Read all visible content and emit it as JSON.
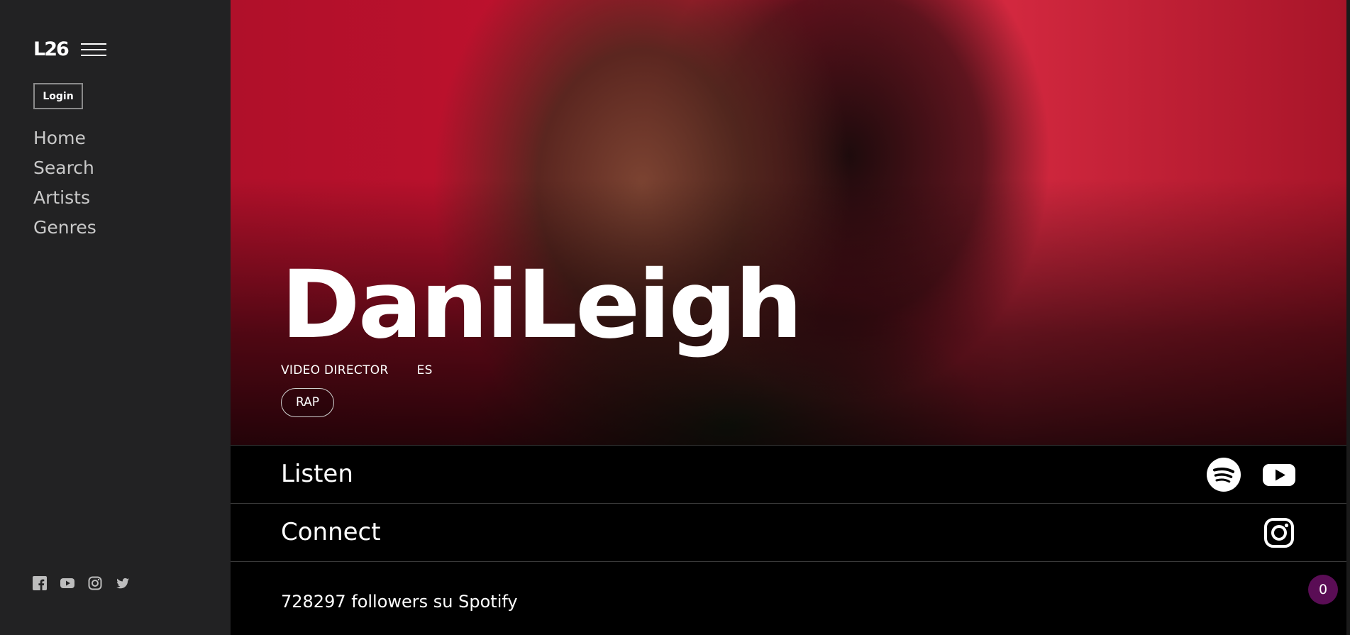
{
  "sidebar": {
    "logo": "L26",
    "login_label": "Login",
    "nav": [
      "Home",
      "Search",
      "Artists",
      "Genres"
    ],
    "social_icons": [
      "facebook-icon",
      "youtube-icon",
      "instagram-icon",
      "twitter-icon"
    ]
  },
  "artist": {
    "name": "DaniLeigh",
    "role": "VIDEO DIRECTOR",
    "country": "ES",
    "genre": "RAP"
  },
  "listen": {
    "title": "Listen",
    "icons": [
      "spotify-icon",
      "youtube-icon"
    ]
  },
  "connect": {
    "title": "Connect",
    "icons": [
      "instagram-icon"
    ]
  },
  "followers_text": "728297 followers su Spotify",
  "badge_count": "0",
  "colors": {
    "sidebar_bg": "#222223",
    "hero_red": "#c4122f",
    "badge_bg": "#5a0d55"
  }
}
